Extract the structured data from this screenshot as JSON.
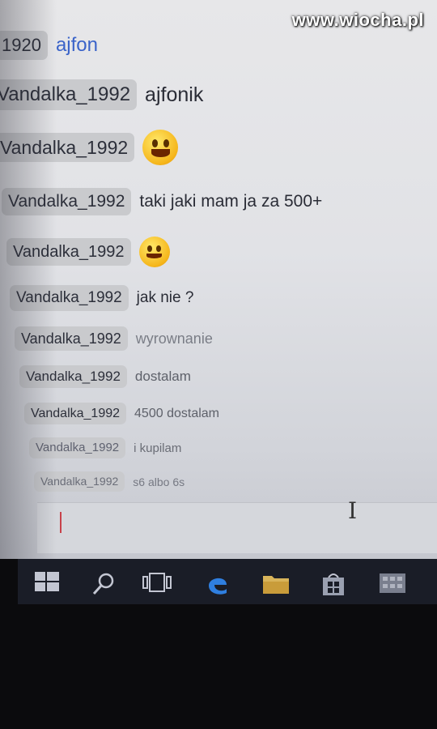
{
  "watermark": "www.wiocha.pl",
  "chat": {
    "messages": [
      {
        "nick": "1920",
        "text": "ajfon"
      },
      {
        "nick": "Vandalka_1992",
        "text": "ajfonik"
      },
      {
        "nick": "Vandalka_1992",
        "emoji": "grin-emoji"
      },
      {
        "nick": "Vandalka_1992",
        "text": "taki jaki mam ja za 500+"
      },
      {
        "nick": "Vandalka_1992",
        "emoji": "smile-emoji"
      },
      {
        "nick": "Vandalka_1992",
        "text": "jak nie ?"
      },
      {
        "nick": "Vandalka_1992",
        "text": "wyrownanie"
      },
      {
        "nick": "Vandalka_1992",
        "text": "dostalam"
      },
      {
        "nick": "Vandalka_1992",
        "text": "4500 dostalam"
      },
      {
        "nick": "Vandalka_1992",
        "text": "i kupilam"
      },
      {
        "nick": "Vandalka_1992",
        "text": "s6 albo 6s"
      }
    ]
  },
  "input": {
    "value": ""
  },
  "taskbar": {
    "icons": [
      "windows-start-icon",
      "search-icon",
      "task-view-icon",
      "edge-browser-icon",
      "file-explorer-icon",
      "store-icon",
      "app-icon"
    ]
  },
  "colors": {
    "link_blue": "#3a63c9",
    "nick_bubble": "#c9cacd",
    "taskbar": "#1a1d27"
  }
}
